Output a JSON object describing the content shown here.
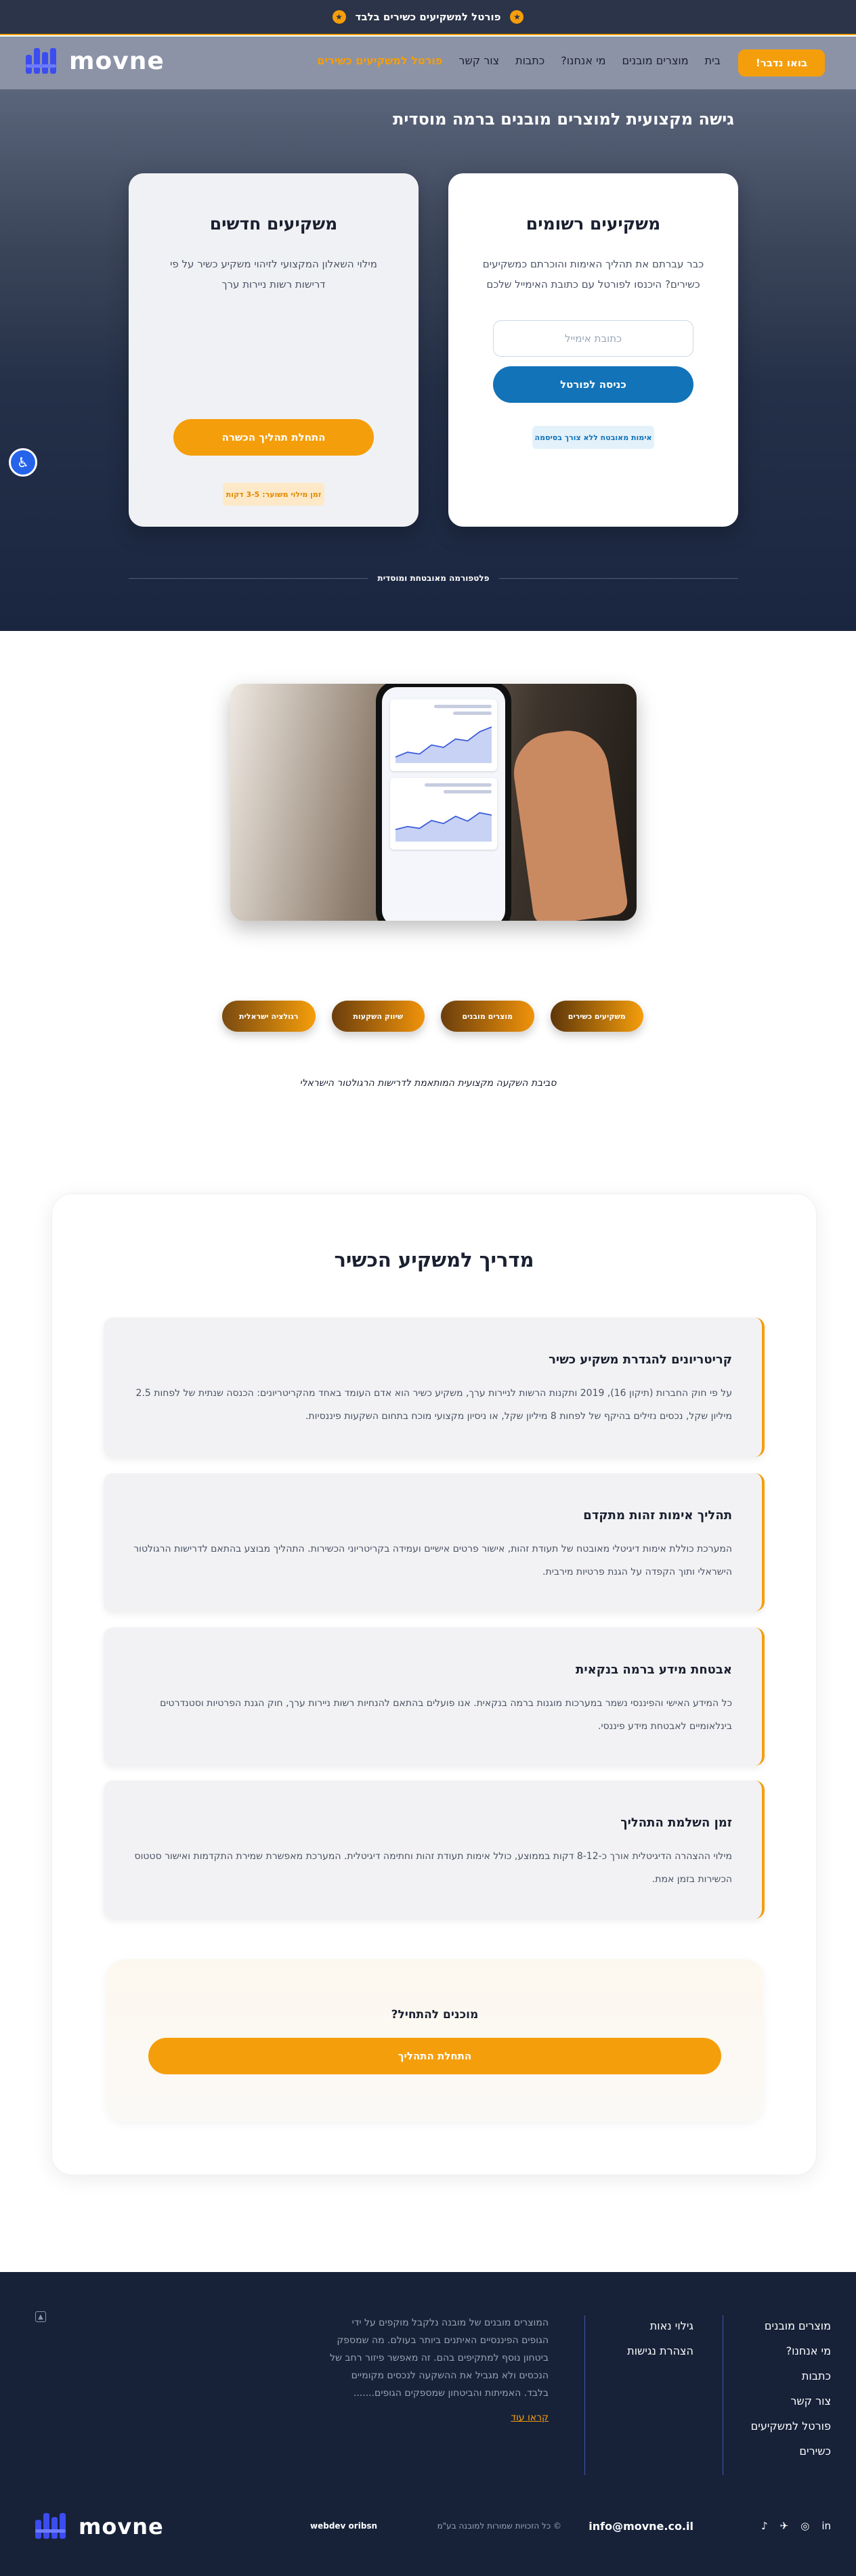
{
  "topbar": {
    "text": "פורטל למשקיעים כשירים בלבד"
  },
  "header": {
    "logo": "movne",
    "cta": "בואו נדבר!",
    "nav": [
      "בית",
      "מוצרים מובנים",
      "מי אנחנו?",
      "כתבות",
      "צור קשר",
      "פורטל למשקיעים כשירים"
    ]
  },
  "hero": {
    "title": "גישה מקצועית למוצרים מובנים ברמה מוסדית",
    "registered": {
      "title": "משקיעים רשומים",
      "text": "כבר עברתם את תהליך האימות והוכרתם כמשקיעים כשירים? היכנסו לפורטל עם כתובת האימייל שלכם",
      "email_placeholder": "כתובת אימייל",
      "login_button": "כניסה לפורטל",
      "note": "אימות מאובטח ללא צורך בסיסמה"
    },
    "new": {
      "title": "משקיעים חדשים",
      "text": "מילוי השאלון המקצועי לזיהוי משקיע כשיר על פי דרישות רשות ניירות ערך",
      "start_button": "התחלת תהליך הכשרה",
      "note": "זמן מילוי משוער: 3-5 דקות"
    },
    "divider": "פלטפורמה מאובטחת ומוסדית",
    "accessibility": "♿"
  },
  "features": {
    "pills": [
      "משקיעים כשירים",
      "מוצרים מובנים",
      "שיווק השקעות",
      "רגולציה ישראלית"
    ],
    "caption": "סביבת השקעה מקצועית המותאמת לדרישות הרגולטור הישראלי"
  },
  "guide": {
    "title": "מדריך למשקיע הכשיר",
    "items": [
      {
        "title": "קריטריונים להגדרת משקיע כשיר",
        "text": "על פי חוק החברות (תיקון 16), 2019 ותקנות הרשות לניירות ערך, משקיע כשיר הוא אדם העומד באחד מהקריטריונים: הכנסה שנתית של לפחות 2.5 מיליון שקל, נכסים נזילים בהיקף של לפחות 8 מיליון שקל, או ניסיון מקצועי מוכח בתחום השקעות פיננסיות."
      },
      {
        "title": "תהליך אימות זהות מתקדם",
        "text": "המערכת כוללת אימות דיגיטלי מאובטח של תעודת זהות, אישור פרטים אישיים ועמידה בקריטריוני הכשירות. התהליך מבוצע בהתאם לדרישות הרגולטור הישראלי ותוך הקפדה על הגנת פרטיות מירבית."
      },
      {
        "title": "אבטחת מידע ברמה בנקאית",
        "text": "כל המידע האישי והפיננסי נשמר במערכות מוגנות ברמה בנקאית. אנו פועלים בהתאם להנחיות רשות ניירות ערך, חוק הגנת הפרטיות וסטנדרטים בינלאומיים לאבטחת מידע פיננסי."
      },
      {
        "title": "זמן השלמת התהליך",
        "text": "מילוי ההצהרה הדיגיטלית אורך כ-8-12 דקות בממוצע, כולל אימות תעודת זהות וחתימה דיגיטלית. המערכת מאפשרת שמירת התקדמות ואישור סטטוס הכשירות בזמן אמת."
      }
    ],
    "ready": {
      "title": "מוכנים להתחיל?",
      "button": "התחלת התהליך"
    }
  },
  "footer": {
    "nav_main": [
      "מוצרים מובנים",
      "מי אנחנו?",
      "כתבות",
      "צור קשר",
      "פורטל למשקיעים",
      "כשירים"
    ],
    "nav_legal": [
      "גילוי נאות",
      "הצהרת נגישות"
    ],
    "about": "המוצרים מובנים של מובנה נלקבל מוקפים על ידי הגופים הפיננסיים האיתנים ביותר בעולם. מה שמספק ביטחון נוסף למתקיפים בהם. זה מאפשר פיזור רחב של הנכסים ולא מגביל את ההשקעה לנכסים מקומיים בלבד. האמיתות והביטחון שמספקים הגופים.......",
    "about_more": "קראו עוד",
    "logo": "movne",
    "email": "info@movne.co.il",
    "copyright": "© כל הזכויות שמורות למובנה בע\"מ",
    "credit": "webdev oribsn",
    "social": [
      "in",
      "◎",
      "✈",
      "♪"
    ]
  },
  "colors": {
    "accent": "#f59e0b",
    "primary_blue": "#1273b8",
    "navy": "#172239"
  }
}
